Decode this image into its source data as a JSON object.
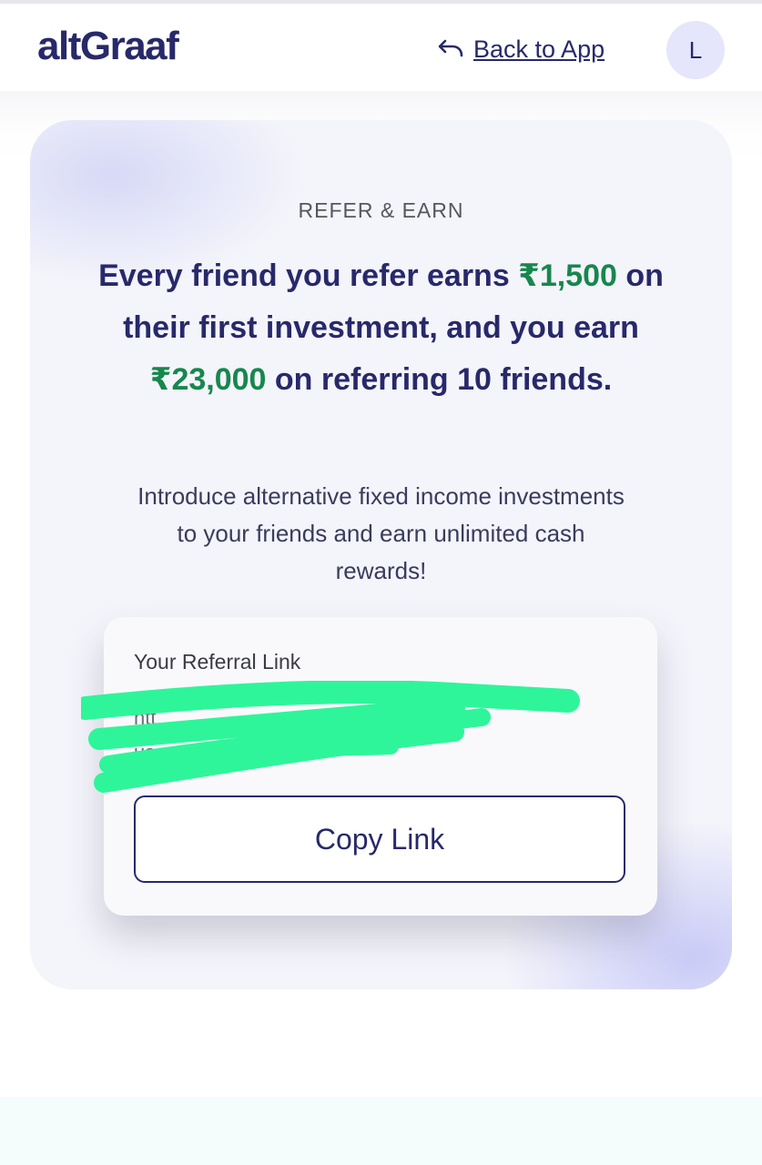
{
  "header": {
    "logo_prefix": "alt",
    "logo_suffix": "Graaf",
    "back_link_label": "Back to App",
    "avatar_initial": "L"
  },
  "referral": {
    "eyebrow": "REFER & EARN",
    "headline": {
      "part1": "Every friend you refer earns ",
      "amount1": "₹1,500",
      "part2": " on their first investment, and you earn ",
      "amount2": "₹23,000",
      "part3": " on referring 10 friends."
    },
    "subtext": "Introduce alternative fixed income investments to your friends and earn unlimited cash rewards!",
    "link_box": {
      "label": "Your Referral Link",
      "link_line1": "htt",
      "link_line2": "uso",
      "copy_button_label": "Copy Link"
    }
  },
  "colors": {
    "brand_navy": "#27296a",
    "amount_green": "#17874d",
    "redaction_green": "#2ef59a",
    "avatar_bg": "#e5e6fb"
  }
}
